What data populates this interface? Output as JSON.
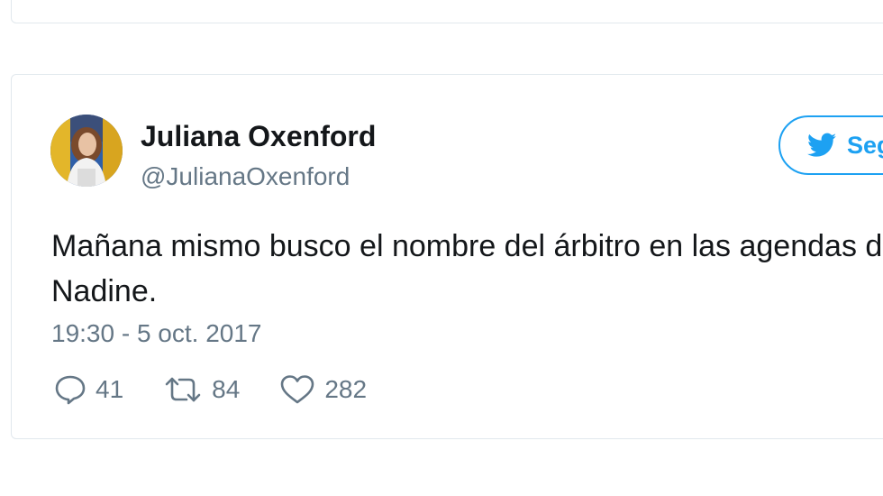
{
  "tweet": {
    "display_name": "Juliana Oxenford",
    "handle": "@JulianaOxenford",
    "follow_label": "Seguir",
    "text": "Mañana mismo busco el nombre del árbitro en las agendas de\nNadine.",
    "timestamp": "19:30 - 5 oct. 2017",
    "actions": {
      "replies": "41",
      "retweets": "84",
      "likes": "282"
    }
  },
  "colors": {
    "accent": "#1da1f2",
    "text": "#14171a",
    "muted": "#657786",
    "border": "#e1e8ed"
  },
  "icons": {
    "follow": "twitter-bird-icon",
    "reply": "reply-icon",
    "retweet": "retweet-icon",
    "like": "heart-icon"
  }
}
